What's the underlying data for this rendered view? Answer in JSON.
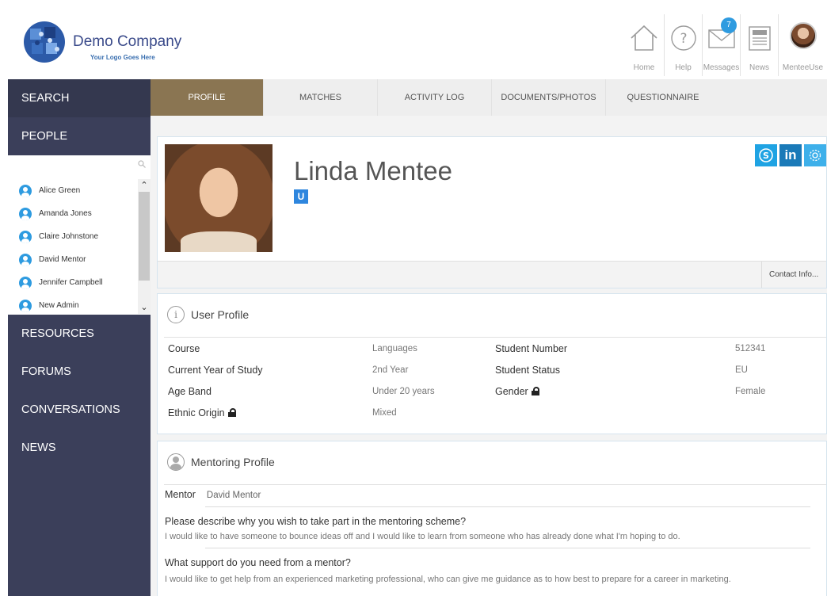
{
  "header": {
    "company_name": "Demo Company",
    "tagline": "Your Logo Goes Here",
    "nav": [
      {
        "label": "Home",
        "icon": "home-icon"
      },
      {
        "label": "Help",
        "icon": "help-icon"
      },
      {
        "label": "Messages",
        "icon": "envelope-icon",
        "badge": "7"
      },
      {
        "label": "News",
        "icon": "newspaper-icon"
      },
      {
        "label": "MenteeUse",
        "icon": "user-avatar"
      }
    ]
  },
  "sidebar": {
    "search": "SEARCH",
    "people": "PEOPLE",
    "people_list": [
      "Alice Green",
      "Amanda Jones",
      "Claire Johnstone",
      "David Mentor",
      "Jennifer Campbell",
      "New Admin"
    ],
    "resources": "RESOURCES",
    "forums": "FORUMS",
    "conversations": "CONVERSATIONS",
    "news": "NEWS"
  },
  "tabs": [
    "PROFILE",
    "MATCHES",
    "ACTIVITY LOG",
    "DOCUMENTS/PHOTOS",
    "QUESTIONNAIRE"
  ],
  "profile": {
    "name": "Linda Mentee",
    "role_badge": "U",
    "linkedin": "in",
    "contact_info": "Contact Info..."
  },
  "user_profile": {
    "title": "User Profile",
    "icon_glyph": "i",
    "fields": [
      {
        "label": "Course",
        "value": "Languages"
      },
      {
        "label": "Current Year of Study",
        "value": "2nd Year"
      },
      {
        "label": "Age Band",
        "value": "Under 20 years"
      },
      {
        "label": "Ethnic Origin",
        "value": "Mixed"
      },
      {
        "label": "Student Number",
        "value": "512341"
      },
      {
        "label": "Student Status",
        "value": "EU"
      },
      {
        "label": "Gender",
        "value": "Female"
      }
    ]
  },
  "mentoring": {
    "title": "Mentoring Profile",
    "mentor_label": "Mentor",
    "mentor_value": "David Mentor",
    "q1": "Please describe why you wish to take part in the mentoring scheme?",
    "a1": "I would like to have someone to bounce ideas off and I would like to learn from someone who has already done what I'm hoping to do.",
    "q2": "What support do you need from a mentor?",
    "a2": "I would like to get help from an experienced marketing professional, who can give me guidance as to how best to prepare for a career in marketing."
  },
  "colors": {
    "sidebar": "#3b3f5a",
    "tab_active": "#8a7552",
    "accent": "#2e9be0"
  }
}
